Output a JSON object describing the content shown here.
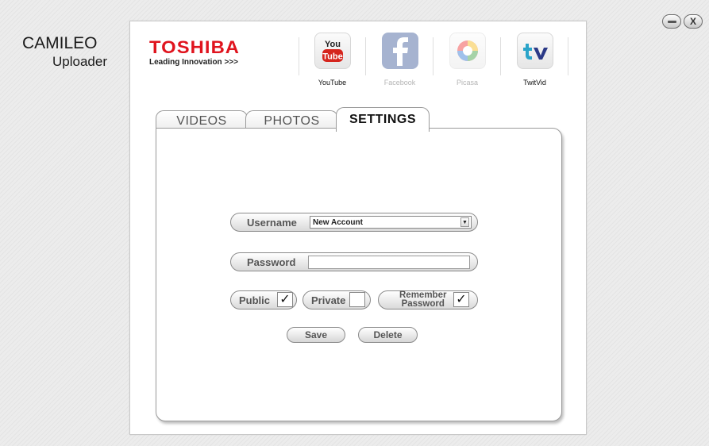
{
  "app": {
    "title": "CAMILEO",
    "subtitle": "Uploader"
  },
  "window_controls": {
    "minimize_icon": "minimize-icon",
    "close_label": "X"
  },
  "brand": {
    "name": "TOSHIBA",
    "tagline": "Leading Innovation >>>",
    "color": "#e0141e"
  },
  "services": [
    {
      "label": "YouTube",
      "icon": "youtube-icon",
      "active": true
    },
    {
      "label": "Facebook",
      "icon": "facebook-icon",
      "active": false
    },
    {
      "label": "Picasa",
      "icon": "picasa-icon",
      "active": false
    },
    {
      "label": "TwitVid",
      "icon": "twitvid-icon",
      "active": true
    }
  ],
  "youtube_logo": {
    "top": "You",
    "bottom": "Tube"
  },
  "tabs": [
    {
      "label": "VIDEOS",
      "active": false
    },
    {
      "label": "PHOTOS",
      "active": false
    },
    {
      "label": "SETTINGS",
      "active": true
    }
  ],
  "settings": {
    "username_label": "Username",
    "username_value": "New Account",
    "password_label": "Password",
    "password_value": "",
    "public_label": "Public",
    "public_checked": true,
    "private_label": "Private",
    "private_checked": false,
    "remember_label_1": "Remember",
    "remember_label_2": "Password",
    "remember_checked": true,
    "check_mark": "✓",
    "save_label": "Save",
    "delete_label": "Delete"
  }
}
